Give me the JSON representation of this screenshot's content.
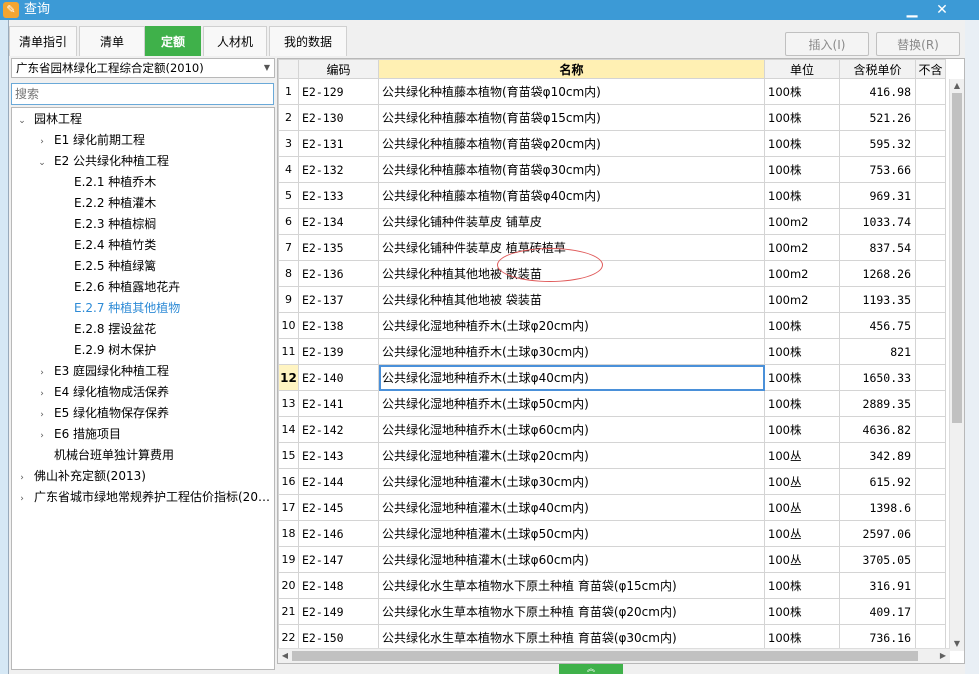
{
  "window": {
    "title": "查询",
    "app_icon": "app-icon",
    "minimize_label": "▁",
    "close_label": "✕"
  },
  "tabs": [
    {
      "label": "清单指引",
      "active": false
    },
    {
      "label": "清单",
      "active": false
    },
    {
      "label": "定额",
      "active": true
    },
    {
      "label": "人材机",
      "active": false
    },
    {
      "label": "我的数据",
      "active": false
    }
  ],
  "buttons": {
    "insert_label": "插入(I)",
    "replace_label": "替换(R)"
  },
  "left_panel": {
    "combo_value": "广东省园林绿化工程综合定额(2010)",
    "search_placeholder": "搜索",
    "tree": [
      {
        "label": "园林工程",
        "toggle": "⌄"
      },
      {
        "label": "E1 绿化前期工程",
        "toggle": "›"
      },
      {
        "label": "E2 公共绿化种植工程",
        "toggle": "⌄"
      },
      {
        "label": "E.2.1 种植乔木",
        "toggle": ""
      },
      {
        "label": "E.2.2 种植灌木",
        "toggle": ""
      },
      {
        "label": "E.2.3 种植棕榈",
        "toggle": ""
      },
      {
        "label": "E.2.4 种植竹类",
        "toggle": ""
      },
      {
        "label": "E.2.5 种植绿篱",
        "toggle": ""
      },
      {
        "label": "E.2.6 种植露地花卉",
        "toggle": ""
      },
      {
        "label": "E.2.7 种植其他植物",
        "toggle": "",
        "selected": true
      },
      {
        "label": "E.2.8 摆设盆花",
        "toggle": ""
      },
      {
        "label": "E.2.9 树木保护",
        "toggle": ""
      },
      {
        "label": "E3 庭园绿化种植工程",
        "toggle": "›"
      },
      {
        "label": "E4 绿化植物成活保养",
        "toggle": "›"
      },
      {
        "label": "E5 绿化植物保存保养",
        "toggle": "›"
      },
      {
        "label": "E6 措施项目",
        "toggle": "›"
      },
      {
        "label": "机械台班单独计算费用",
        "toggle": ""
      },
      {
        "label": "佛山补充定额(2013)",
        "toggle": "›"
      },
      {
        "label": "广东省城市绿地常规养护工程估价指标(20…",
        "toggle": "›"
      }
    ]
  },
  "grid": {
    "headers": {
      "num": "",
      "code": "编码",
      "name": "名称",
      "unit": "单位",
      "price": "含税单价",
      "extra": "不含"
    },
    "rows": [
      {
        "num": "1",
        "code": "E2-129",
        "name": "公共绿化种植藤本植物(育苗袋φ10cm内)",
        "unit": "100株",
        "price": "416.98"
      },
      {
        "num": "2",
        "code": "E2-130",
        "name": "公共绿化种植藤本植物(育苗袋φ15cm内)",
        "unit": "100株",
        "price": "521.26"
      },
      {
        "num": "3",
        "code": "E2-131",
        "name": "公共绿化种植藤本植物(育苗袋φ20cm内)",
        "unit": "100株",
        "price": "595.32"
      },
      {
        "num": "4",
        "code": "E2-132",
        "name": "公共绿化种植藤本植物(育苗袋φ30cm内)",
        "unit": "100株",
        "price": "753.66"
      },
      {
        "num": "5",
        "code": "E2-133",
        "name": "公共绿化种植藤本植物(育苗袋φ40cm内)",
        "unit": "100株",
        "price": "969.31"
      },
      {
        "num": "6",
        "code": "E2-134",
        "name": "公共绿化铺种件装草皮 铺草皮",
        "unit": "100m2",
        "price": "1033.74"
      },
      {
        "num": "7",
        "code": "E2-135",
        "name": "公共绿化铺种件装草皮 植草砖植草",
        "unit": "100m2",
        "price": "837.54"
      },
      {
        "num": "8",
        "code": "E2-136",
        "name": "公共绿化种植其他地被 散装苗",
        "unit": "100m2",
        "price": "1268.26"
      },
      {
        "num": "9",
        "code": "E2-137",
        "name": "公共绿化种植其他地被 袋装苗",
        "unit": "100m2",
        "price": "1193.35"
      },
      {
        "num": "10",
        "code": "E2-138",
        "name": "公共绿化湿地种植乔木(土球φ20cm内)",
        "unit": "100株",
        "price": "456.75"
      },
      {
        "num": "11",
        "code": "E2-139",
        "name": "公共绿化湿地种植乔木(土球φ30cm内)",
        "unit": "100株",
        "price": "821"
      },
      {
        "num": "12",
        "code": "E2-140",
        "name": "公共绿化湿地种植乔木(土球φ40cm内)",
        "unit": "100株",
        "price": "1650.33",
        "current": true
      },
      {
        "num": "13",
        "code": "E2-141",
        "name": "公共绿化湿地种植乔木(土球φ50cm内)",
        "unit": "100株",
        "price": "2889.35"
      },
      {
        "num": "14",
        "code": "E2-142",
        "name": "公共绿化湿地种植乔木(土球φ60cm内)",
        "unit": "100株",
        "price": "4636.82"
      },
      {
        "num": "15",
        "code": "E2-143",
        "name": "公共绿化湿地种植灌木(土球φ20cm内)",
        "unit": "100丛",
        "price": "342.89"
      },
      {
        "num": "16",
        "code": "E2-144",
        "name": "公共绿化湿地种植灌木(土球φ30cm内)",
        "unit": "100丛",
        "price": "615.92"
      },
      {
        "num": "17",
        "code": "E2-145",
        "name": "公共绿化湿地种植灌木(土球φ40cm内)",
        "unit": "100丛",
        "price": "1398.6"
      },
      {
        "num": "18",
        "code": "E2-146",
        "name": "公共绿化湿地种植灌木(土球φ50cm内)",
        "unit": "100丛",
        "price": "2597.06"
      },
      {
        "num": "19",
        "code": "E2-147",
        "name": "公共绿化湿地种植灌木(土球φ60cm内)",
        "unit": "100丛",
        "price": "3705.05"
      },
      {
        "num": "20",
        "code": "E2-148",
        "name": "公共绿化水生草本植物水下原土种植 育苗袋(φ15cm内)",
        "unit": "100株",
        "price": "316.91"
      },
      {
        "num": "21",
        "code": "E2-149",
        "name": "公共绿化水生草本植物水下原土种植 育苗袋(φ20cm内)",
        "unit": "100株",
        "price": "409.17"
      },
      {
        "num": "22",
        "code": "E2-150",
        "name": "公共绿化水生草本植物水下原土种植 育苗袋(φ30cm内)",
        "unit": "100株",
        "price": "736.16"
      }
    ]
  },
  "colors": {
    "titlebar": "#3c9ad6",
    "active_tab": "#3fb14a",
    "name_header": "#fff0b3",
    "selection": "#2e8bd6",
    "annotation": "#e05a5a"
  },
  "icons": {
    "app": "app-icon",
    "combo_arrow": "chevron-down-icon",
    "scroll_up": "arrow-up-icon",
    "scroll_down": "arrow-down-icon"
  }
}
